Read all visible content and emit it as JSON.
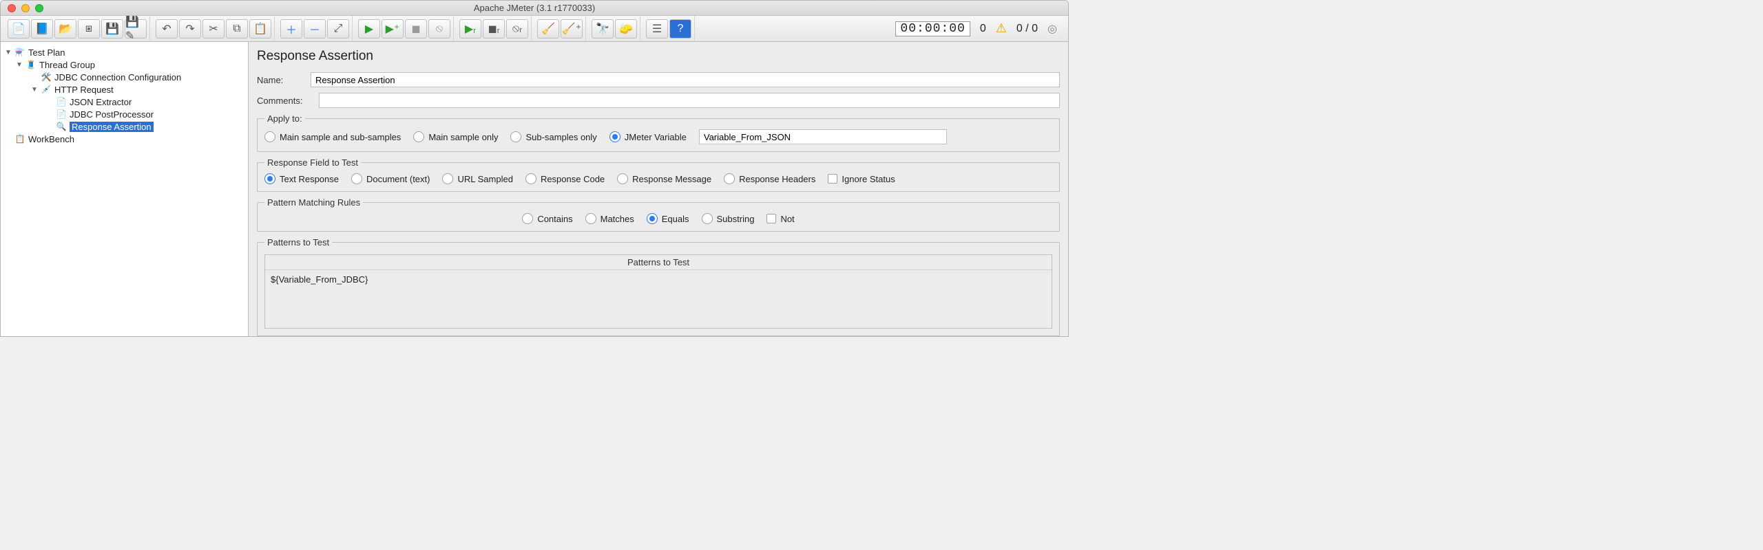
{
  "title": "Apache JMeter (3.1 r1770033)",
  "timer": "00:00:00",
  "warn_count": "0",
  "active_threads": "0 / 0",
  "tree": {
    "test_plan": "Test Plan",
    "thread_group": "Thread Group",
    "jdbc_conn": "JDBC Connection Configuration",
    "http_request": "HTTP Request",
    "json_extractor": "JSON Extractor",
    "jdbc_post": "JDBC PostProcessor",
    "response_assertion": "Response Assertion",
    "workbench": "WorkBench"
  },
  "panel": {
    "heading": "Response Assertion",
    "name_label": "Name:",
    "name_value": "Response Assertion",
    "comments_label": "Comments:",
    "apply_to": {
      "legend": "Apply to:",
      "main_and_sub": "Main sample and sub-samples",
      "main_only": "Main sample only",
      "sub_only": "Sub-samples only",
      "jmeter_var": "JMeter Variable",
      "jmeter_var_value": "Variable_From_JSON"
    },
    "field_to_test": {
      "legend": "Response Field to Test",
      "text_response": "Text Response",
      "document": "Document (text)",
      "url_sampled": "URL Sampled",
      "response_code": "Response Code",
      "response_message": "Response Message",
      "response_headers": "Response Headers",
      "ignore_status": "Ignore Status"
    },
    "pattern_rules": {
      "legend": "Pattern Matching Rules",
      "contains": "Contains",
      "matches": "Matches",
      "equals": "Equals",
      "substring": "Substring",
      "not": "Not"
    },
    "patterns": {
      "legend": "Patterns to Test",
      "header": "Patterns to Test",
      "row0": "${Variable_From_JDBC}"
    }
  }
}
